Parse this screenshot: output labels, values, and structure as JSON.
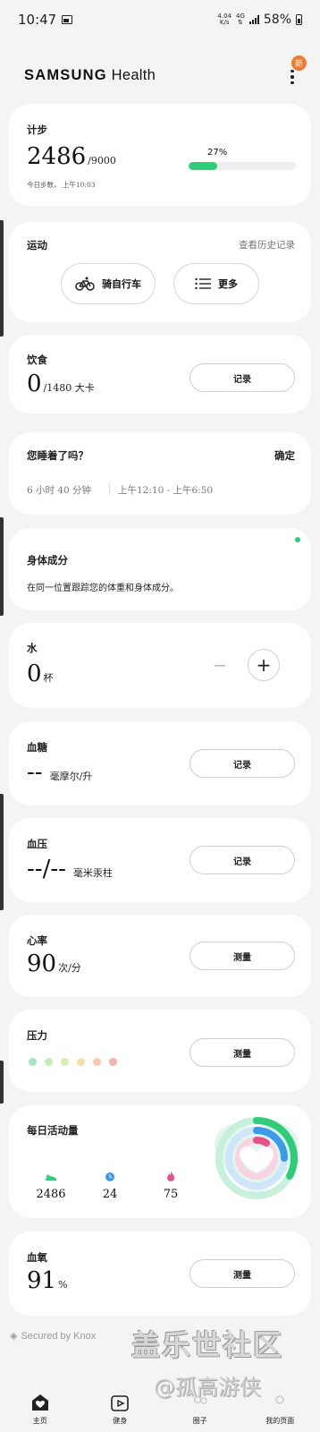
{
  "status_bar": {
    "time": "10:47",
    "net_speed_top": "4.04",
    "net_speed_bottom": "K/s",
    "network": "4G",
    "battery": "58%"
  },
  "header": {
    "app_title_bold": "SAMSUNG",
    "app_title_rest": " Health",
    "new_badge": "新"
  },
  "steps": {
    "title": "计步",
    "value": "2486",
    "goal": "/9000",
    "percent": "27%",
    "progress": 0.27,
    "subtitle": "今日步数， 上午10:03",
    "accent": "#2fcc7a"
  },
  "exercise": {
    "title": "运动",
    "history_link": "查看历史记录",
    "cycling_label": "骑自行车",
    "more_label": "更多"
  },
  "food": {
    "title": "饮食",
    "value": "0",
    "goal": "/1480 大卡",
    "button": "记录"
  },
  "sleep": {
    "title": "您睡着了吗？",
    "confirm": "确定",
    "duration": "6 小时 40 分钟",
    "range": "上午12:10 - 上午6:50"
  },
  "body": {
    "title": "身体成分",
    "desc": "在同一位置跟踪您的体重和身体成分。"
  },
  "water": {
    "title": "水",
    "value": "0",
    "unit": "杯",
    "minus": "−",
    "plus": "+"
  },
  "glucose": {
    "title": "血糖",
    "value": "--",
    "unit": "毫摩尔/升",
    "button": "记录"
  },
  "pressure": {
    "title": "血压",
    "value": "--/--",
    "unit": "毫米汞柱",
    "button": "记录"
  },
  "heart": {
    "title": "心率",
    "value": "90",
    "unit": "次/分",
    "button": "测量"
  },
  "stress": {
    "title": "压力",
    "button": "测量",
    "dot_colors": [
      "#a8e6c4",
      "#c4ecb8",
      "#d9efb0",
      "#f5e0a8",
      "#f7c9b0",
      "#f5b3aa"
    ]
  },
  "activity": {
    "title": "每日活动量",
    "steps": "2486",
    "minutes": "24",
    "calories": "75"
  },
  "spo2": {
    "title": "血氧",
    "value": "91",
    "unit": "%",
    "button": "测量"
  },
  "footer": {
    "knox": "Secured by Knox",
    "watermark_1": "盖乐世社区",
    "watermark_2": "@孤高游侠"
  },
  "nav": {
    "home": "主页",
    "fitness": "健身",
    "together": "圈子",
    "my_page": "我的页面"
  }
}
